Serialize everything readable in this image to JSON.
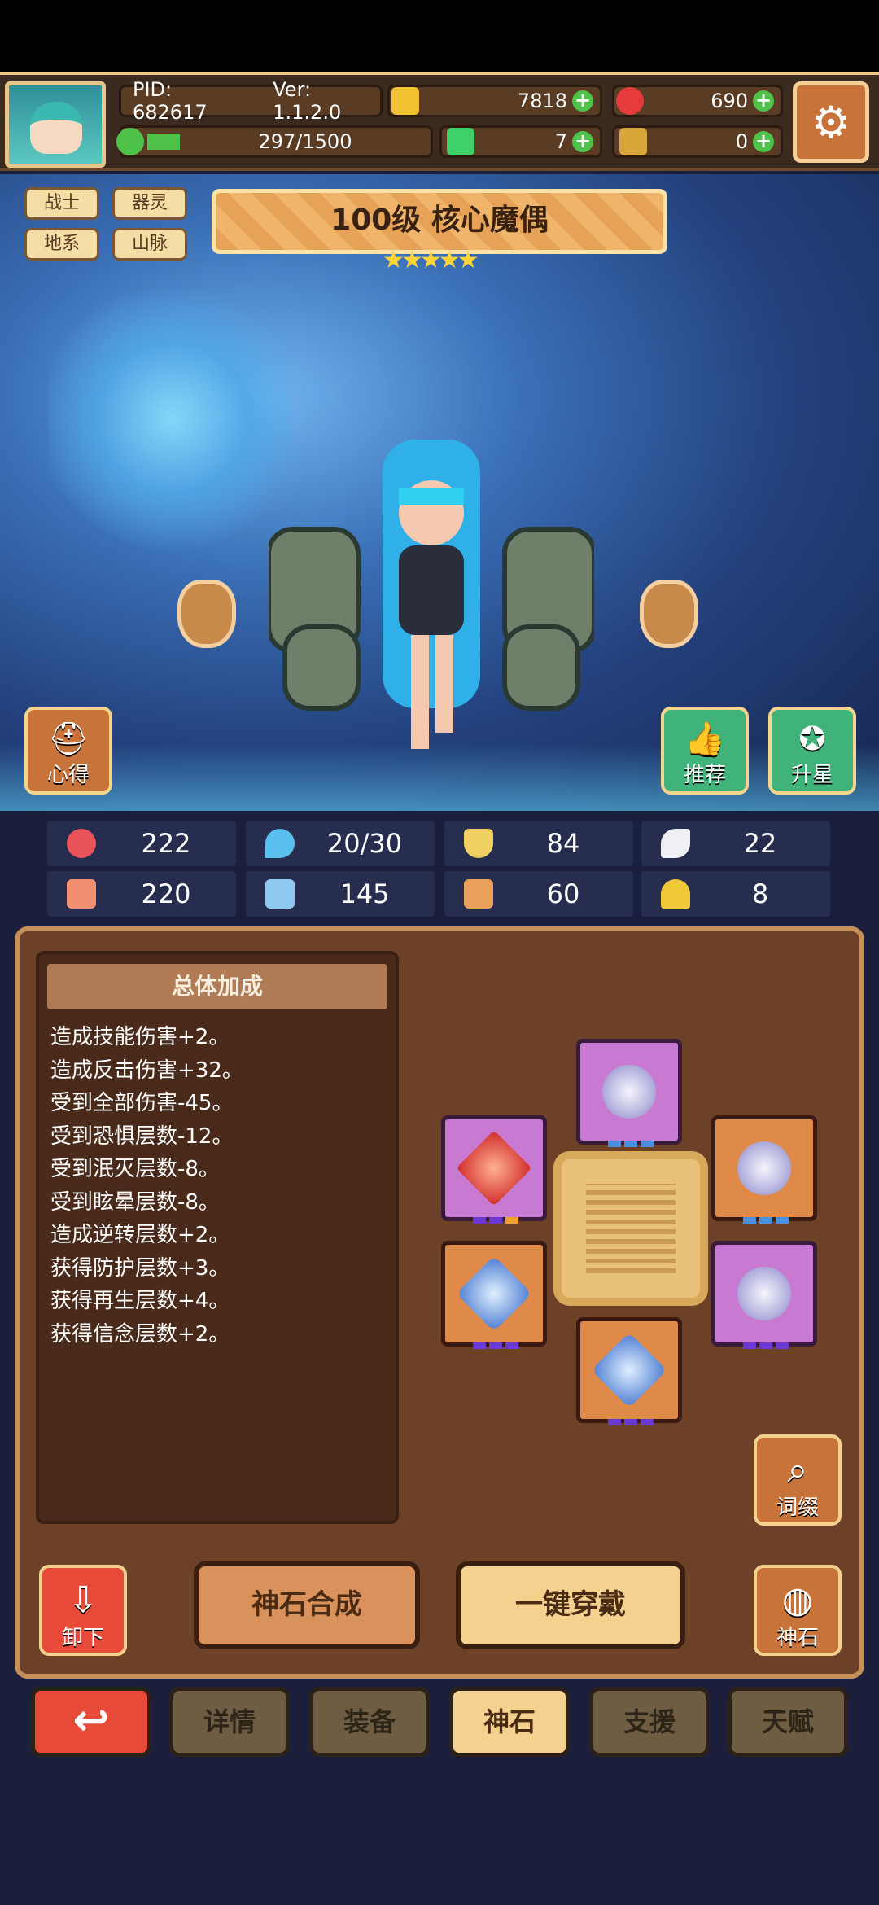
{
  "header": {
    "pid": "PID: 682617",
    "version": "Ver: 1.1.2.0",
    "gold": "7818",
    "gems": "690",
    "stamina": "297/1500",
    "clover": "7",
    "keys": "0"
  },
  "character": {
    "tags": [
      "战士",
      "器灵",
      "地系",
      "山脉"
    ],
    "title": "100级  核心魔偶",
    "stars": 5,
    "left_button": "心得",
    "right_buttons": [
      "推荐",
      "升星"
    ]
  },
  "stats": [
    {
      "icon": "heart-icon",
      "value": "222"
    },
    {
      "icon": "mana-drop-icon",
      "value": "20/30"
    },
    {
      "icon": "shield-icon",
      "value": "84"
    },
    {
      "icon": "wing-icon",
      "value": "22"
    },
    {
      "icon": "fist-icon",
      "value": "220"
    },
    {
      "icon": "book-icon",
      "value": "145"
    },
    {
      "icon": "scroll-icon",
      "value": "60"
    },
    {
      "icon": "horseshoe-icon",
      "value": "8"
    }
  ],
  "bonus": {
    "title": "总体加成",
    "lines": [
      "造成技能伤害+2。",
      "造成反击伤害+32。",
      "受到全部伤害-45。",
      "受到恐惧层数-12。",
      "受到泯灭层数-8。",
      "受到眩晕层数-8。",
      "造成逆转层数+2。",
      "获得防护层数+3。",
      "获得再生层数+4。",
      "获得信念层数+2。"
    ]
  },
  "buttons": {
    "affix": "词缀",
    "unequip": "卸下",
    "synthesize": "神石合成",
    "equip_all": "一键穿戴",
    "godstone": "神石"
  },
  "tabs": [
    "详情",
    "装备",
    "神石",
    "支援",
    "天赋"
  ],
  "active_tab": "神石",
  "colors": {
    "panel": "#6d4128",
    "accent_orange": "#e08a4a",
    "accent_purple": "#c87ad3",
    "back_red": "#e84a3a"
  }
}
